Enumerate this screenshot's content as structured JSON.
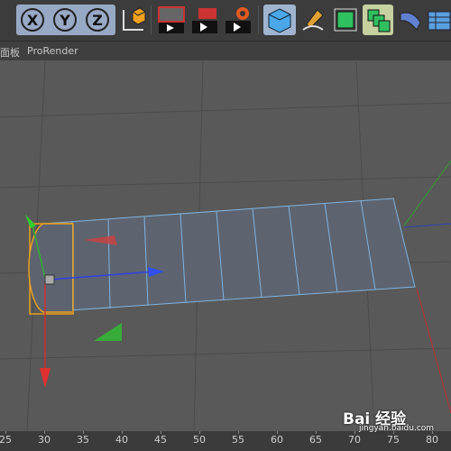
{
  "toolbar": {
    "x_label": "X",
    "y_label": "Y",
    "z_label": "Z",
    "buttons": [
      "coordinate-system-icon",
      "render-view-icon",
      "render-picture-queue-icon",
      "render-settings-icon",
      "cube-icon",
      "pen-spline-icon",
      "subdivision-icon",
      "array-icon",
      "deformer-icon",
      "floor-icon"
    ]
  },
  "menubar": {
    "panel_label": "面板",
    "prorender_label": "ProRender"
  },
  "ruler": {
    "ticks": [
      "25",
      "30",
      "35",
      "40",
      "45",
      "50",
      "55",
      "60",
      "65",
      "70",
      "75",
      "80"
    ]
  },
  "watermark": {
    "brand": "Bai 经验",
    "site": "jingyan.baidu.com"
  },
  "colors": {
    "toolbar_bg": "#3c3c3c",
    "axis_group_bg": "#98a9c6",
    "viewport_bg": "#595959",
    "grid": "#4a4a4a",
    "mesh_fill": "#5c6470",
    "mesh_edge": "#7fb3e0",
    "selection": "#f0a020",
    "x_axis": "#e03030",
    "y_axis": "#30c030",
    "z_axis": "#3050e0"
  }
}
